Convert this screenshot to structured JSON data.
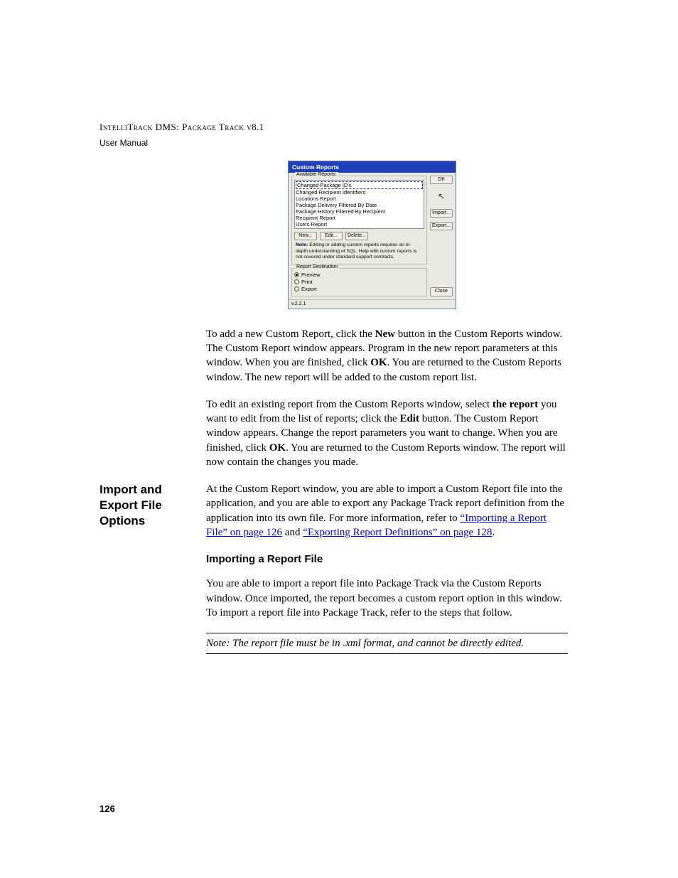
{
  "header": {
    "line1_pre": "I",
    "line1_sc1": "ntelli",
    "line1_mid": "T",
    "line1_sc2": "rack",
    "line1_dms": " DMS: P",
    "line1_sc3": "ackage",
    "line1_trk": " T",
    "line1_sc4": "rack v",
    "line1_ver": "8.1",
    "line2": "User Manual"
  },
  "dialog": {
    "title": "Custom Reports",
    "available_label": "Available Reports:",
    "reports": [
      "Changed Package ID's",
      "Changed Recipient Identifiers",
      "Locations Report",
      "Package Delivery Filtered By Date",
      "Package History Filtered By Recipient",
      "Recipient Report",
      "Users Report"
    ],
    "btn_new": "New...",
    "btn_edit": "Edit...",
    "btn_delete": "Delete...",
    "note_label": "Note:",
    "note_text": " Editing or adding custom reports requires an in-depth understanding of SQL.  Help with custom reports is not covered under standard support contracts.",
    "dest_label": "Report Destination",
    "radio_preview": "Preview",
    "radio_print": "Print",
    "radio_export": "Export",
    "btn_ok": "OK",
    "btn_import": "Import...",
    "btn_export": "Export...",
    "btn_close": "Close",
    "version": "v.2.2.1"
  },
  "para1": {
    "a": "To add a new Custom Report, click the ",
    "b": "New",
    "c": " button in the Custom Reports window. The Custom Report window appears. Program in the new report parameters at this window. When you are finished, click ",
    "d": "OK",
    "e": ". You are returned to the Custom Reports window. The new report will be added to the custom report list."
  },
  "para2": {
    "a": "To edit an existing report from the Custom Reports window, select ",
    "b": "the report",
    "c": " you want to edit from the list of reports; click the ",
    "d": "Edit",
    "e": " button. The Custom Report window appears. Change the report parameters you want to change. When you are finished, click ",
    "f": "OK",
    "g": ". You are returned to the Custom Reports window. The report will now contain the changes you made."
  },
  "section_title": "Import and Export File Options",
  "para3": {
    "a": "At the Custom Report window, you are able to import a Custom Report file into the application, and you are able to export any Package Track report definition from the application into its own file. For more information, refer to ",
    "link1": "“Importing a Report File” on page 126",
    "b": " and ",
    "link2": "“Exporting Report Definitions” on page 128",
    "c": "."
  },
  "subheading": "Importing a Report File",
  "para4": "You are able to import a report file into Package Track via the Custom Reports window. Once imported, the report becomes a custom report option in this window. To import a report file into Package Track, refer to the steps that follow.",
  "note_block": "Note:   The report file must be in .xml format, and cannot be directly edited.",
  "page_number": "126"
}
